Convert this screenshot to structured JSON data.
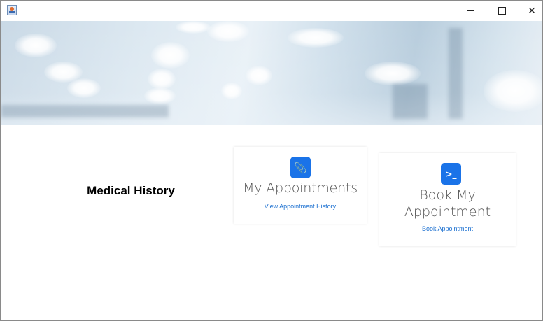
{
  "window": {
    "icon": "java-app-icon",
    "controls": {
      "minimize": "–",
      "maximize": "□",
      "close": "✕"
    }
  },
  "banner": {
    "image": "blurred-hospital-corridor"
  },
  "main": {
    "section_title": "Medical History"
  },
  "cards": {
    "appointments": {
      "icon": "paperclip-icon",
      "icon_glyph": "📎",
      "title": "My Appointments",
      "link": "View Appointment History"
    },
    "book": {
      "icon": "terminal-icon",
      "icon_glyph": ">_",
      "title_line1": "Book My",
      "title_line2": "Appointment",
      "link": "Book Appointment"
    }
  },
  "colors": {
    "accent": "#1a73e8",
    "link": "#1a6fd0",
    "title_text": "#555555"
  }
}
